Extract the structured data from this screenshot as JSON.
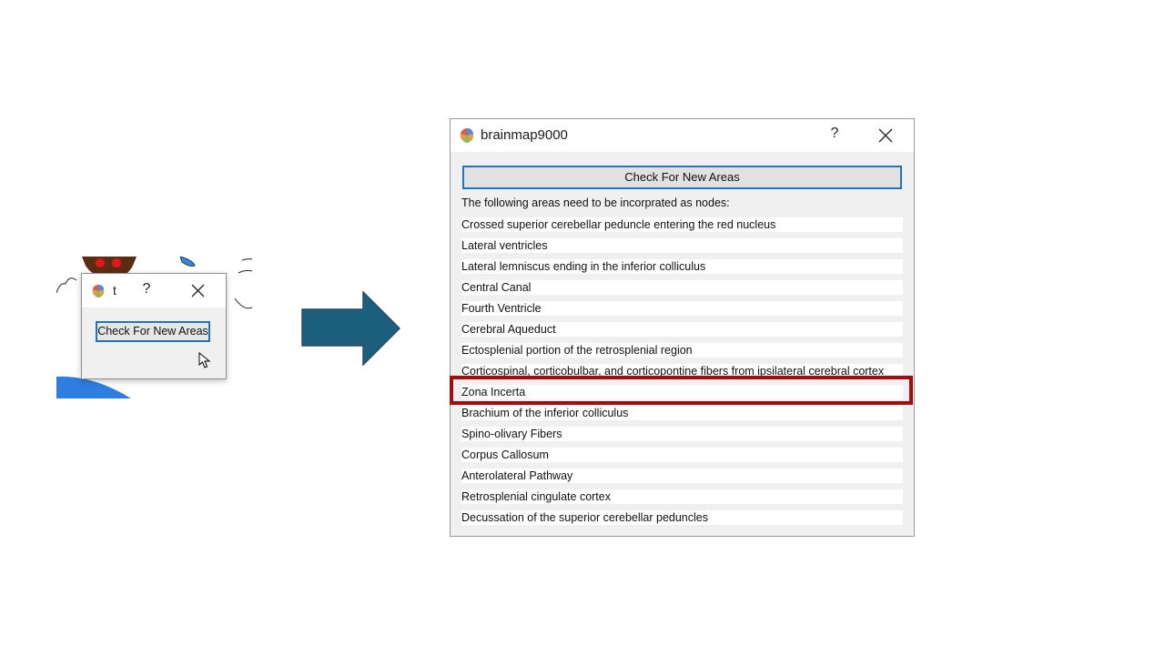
{
  "mini_dialog": {
    "title_fragment": "t",
    "help_label": "?",
    "check_button_label": "Check For New Areas"
  },
  "dialog": {
    "title": "brainmap9000",
    "help_label": "?",
    "check_button_label": "Check For New Areas",
    "info_label": "The following areas need to be incorprated as nodes:",
    "areas": [
      "Crossed superior cerebellar peduncle entering the red nucleus",
      "Lateral ventricles",
      "Lateral lemniscus ending in the inferior colliculus",
      "Central Canal",
      "Fourth Ventricle",
      "Cerebral Aqueduct",
      "Ectosplenial portion of the retrosplenial region",
      "Corticospinal, corticobulbar, and corticopontine fibers from ipsilateral cerebral cortex",
      "Zona Incerta",
      "Brachium of the inferior colliculus",
      "Spino-olivary Fibers",
      "Corpus Callosum",
      "Anterolateral Pathway",
      "Retrosplenial cingulate cortex",
      "Decussation of the superior cerebellar peduncles"
    ],
    "highlighted_area": "Zona Incerta"
  },
  "colors": {
    "arrow": "#1b5e7e",
    "highlight": "#a50d0d",
    "focus_border": "#1f74c4",
    "dialog_bg": "#f0f0f0"
  },
  "icons": [
    "brain-app-icon",
    "close-icon",
    "help-icon",
    "mouse-cursor-icon",
    "right-arrow-icon"
  ]
}
